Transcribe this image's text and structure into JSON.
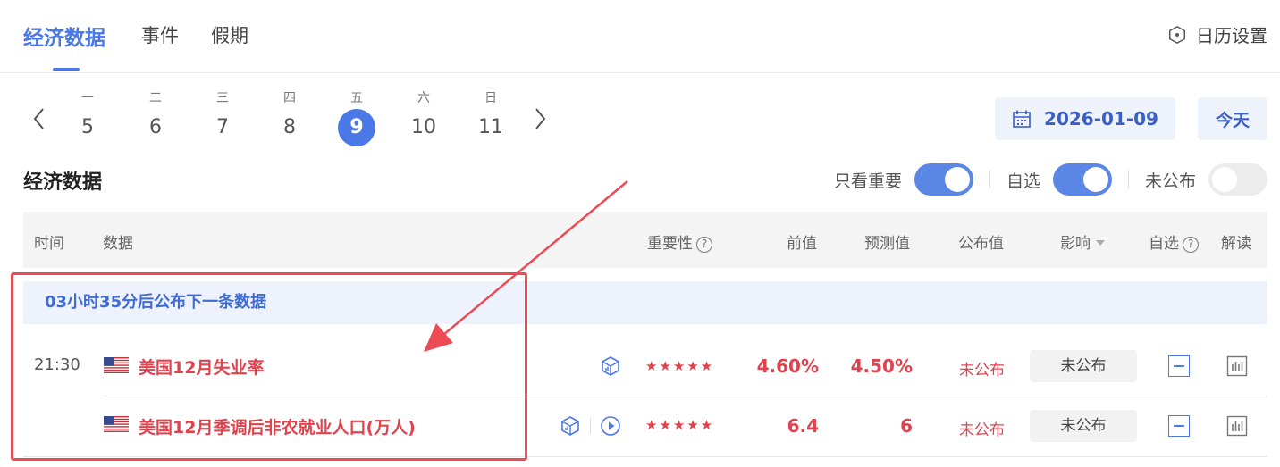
{
  "tabs": [
    {
      "label": "经济数据",
      "active": true
    },
    {
      "label": "事件",
      "active": false
    },
    {
      "label": "假期",
      "active": false
    }
  ],
  "calendar_settings_label": "日历设置",
  "week": [
    {
      "weekday": "一",
      "day": "5"
    },
    {
      "weekday": "二",
      "day": "6"
    },
    {
      "weekday": "三",
      "day": "7"
    },
    {
      "weekday": "四",
      "day": "8"
    },
    {
      "weekday": "五",
      "day": "9",
      "selected": true
    },
    {
      "weekday": "六",
      "day": "10"
    },
    {
      "weekday": "日",
      "day": "11"
    }
  ],
  "date_picker_value": "2026-01-09",
  "today_label": "今天",
  "section_title": "经济数据",
  "filters": [
    {
      "label": "只看重要",
      "on": true
    },
    {
      "label": "自选",
      "on": true
    },
    {
      "label": "未公布",
      "on": false
    }
  ],
  "table": {
    "headers": {
      "time": "时间",
      "data": "数据",
      "importance": "重要性",
      "previous": "前值",
      "forecast": "预测值",
      "actual": "公布值",
      "impact": "影响",
      "watchlist": "自选",
      "analysis": "解读"
    },
    "countdown": "03小时35分后公布下一条数据",
    "rows": [
      {
        "time": "21:30",
        "country": "us-flag",
        "name": "美国12月失业率",
        "stars": 5,
        "previous": "4.60%",
        "forecast": "4.50%",
        "actual": "未公布",
        "impact": "未公布"
      },
      {
        "time": "",
        "country": "us-flag",
        "name": "美国12月季调后非农就业人口(万人)",
        "stars": 5,
        "previous": "6.4",
        "forecast": "6",
        "actual": "未公布",
        "impact": "未公布"
      }
    ]
  },
  "colors": {
    "accent": "#4a78e6",
    "highlight_red": "#e0424e",
    "annotation_red": "#ec4b55"
  }
}
